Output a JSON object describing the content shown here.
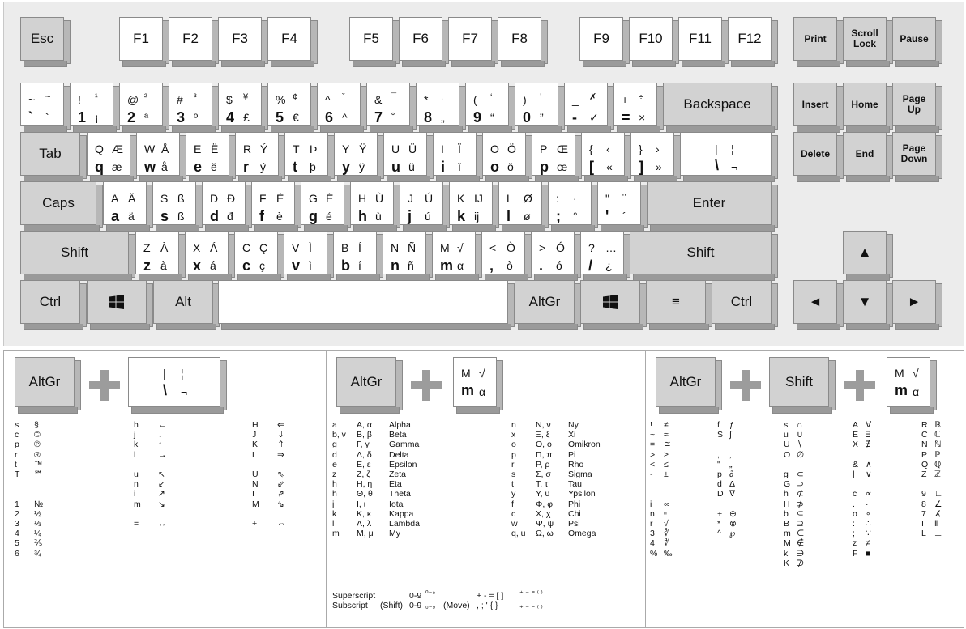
{
  "keyboard": {
    "function_row": [
      "Esc",
      "F1",
      "F2",
      "F3",
      "F4",
      "F5",
      "F6",
      "F7",
      "F8",
      "F9",
      "F10",
      "F11",
      "F12"
    ],
    "nav_top": [
      "Print",
      "Scroll\nLock",
      "Pause"
    ],
    "nav_mid": [
      "Insert",
      "Home",
      "Page\nUp"
    ],
    "nav_bot": [
      "Delete",
      "End",
      "Page\nDown"
    ],
    "arrows": {
      "up": "▲",
      "left": "◄",
      "down": "▼",
      "right": "►"
    },
    "number_row": [
      [
        "~",
        "~",
        "`",
        "`"
      ],
      [
        "!",
        "¹",
        "1",
        "¡"
      ],
      [
        "@",
        "²",
        "2",
        "ª"
      ],
      [
        "#",
        "³",
        "3",
        "º"
      ],
      [
        "$",
        "¥",
        "4",
        "£"
      ],
      [
        "%",
        "¢",
        "5",
        "€"
      ],
      [
        "^",
        "ˇ",
        "6",
        "^"
      ],
      [
        "&",
        "¯",
        "7",
        "˚"
      ],
      [
        "*",
        ",",
        "8",
        "„"
      ],
      [
        "(",
        "‘",
        "9",
        "“"
      ],
      [
        ")",
        "’",
        "0",
        "”"
      ],
      [
        "_",
        "✗",
        "-",
        "✓"
      ],
      [
        "+",
        "÷",
        "=",
        "×"
      ]
    ],
    "backspace": "Backspace",
    "tab": "Tab",
    "q_row": [
      [
        "Q",
        "Æ",
        "q",
        "æ"
      ],
      [
        "W",
        "Å",
        "w",
        "å"
      ],
      [
        "E",
        "Ë",
        "e",
        "ë"
      ],
      [
        "R",
        "Ý",
        "r",
        "ý"
      ],
      [
        "T",
        "Þ",
        "t",
        "þ"
      ],
      [
        "Y",
        "Ÿ",
        "y",
        "ÿ"
      ],
      [
        "U",
        "Ü",
        "u",
        "ü"
      ],
      [
        "I",
        "Ï",
        "i",
        "ï"
      ],
      [
        "O",
        "Ö",
        "o",
        "ö"
      ],
      [
        "P",
        "Œ",
        "p",
        "œ"
      ],
      [
        "{",
        "‹",
        "[",
        "«"
      ],
      [
        "}",
        "›",
        "]",
        "»"
      ],
      [
        "|",
        "¦",
        "\\",
        "¬"
      ]
    ],
    "caps": "Caps",
    "a_row": [
      [
        "A",
        "Ä",
        "a",
        "ä"
      ],
      [
        "S",
        "ß",
        "s",
        "ß"
      ],
      [
        "D",
        "Đ",
        "d",
        "đ"
      ],
      [
        "F",
        "È",
        "f",
        "è"
      ],
      [
        "G",
        "É",
        "g",
        "é"
      ],
      [
        "H",
        "Ù",
        "h",
        "ù"
      ],
      [
        "J",
        "Ú",
        "j",
        "ú"
      ],
      [
        "K",
        "IJ",
        "k",
        "ij"
      ],
      [
        "L",
        "Ø",
        "l",
        "ø"
      ],
      [
        ":",
        "·",
        ";",
        "°"
      ],
      [
        "\"",
        "¨",
        "'",
        "´"
      ]
    ],
    "enter": "Enter",
    "shift": "Shift",
    "z_row": [
      [
        "Z",
        "À",
        "z",
        "à"
      ],
      [
        "X",
        "Á",
        "x",
        "á"
      ],
      [
        "C",
        "Ç",
        "c",
        "ç"
      ],
      [
        "V",
        "Ì",
        "v",
        "ì"
      ],
      [
        "B",
        "Í",
        "b",
        "í"
      ],
      [
        "N",
        "Ñ",
        "n",
        "ñ"
      ],
      [
        "M",
        "√",
        "m",
        "α"
      ],
      [
        "<",
        "Ò",
        ",",
        "ò"
      ],
      [
        ">",
        "Ó",
        ".",
        "ó"
      ],
      [
        "?",
        "…",
        "/",
        "¿"
      ]
    ],
    "bottom": {
      "ctrl": "Ctrl",
      "alt": "Alt",
      "altgr": "AltGr",
      "menu": "≡",
      "win": "win"
    }
  },
  "reference": {
    "panel1": {
      "keys": [
        "AltGr",
        "+"
      ],
      "key_glyphs": [
        "|",
        "¦",
        "\\",
        "¬"
      ],
      "cols": [
        "s\nc\np\nr\nt\nT\n\n\n1\n2\n3\n4\n5\n6",
        "§\n©\n℗\n®\n™\n℠\n\n\n№\n½\n⅓\n¼\n⅖\n¾",
        "h\nj\nk\nl\n\nu\nn\ni\nm\n\n=",
        "←\n↓\n↑\n→\n\n↖\n↙\n↗\n↘\n\n↔",
        "H\nJ\nK\nL\n\nU\nN\nI\nM\n\n+",
        "⇐\n⇓\n⇑\n⇒\n\n⇖\n⇙\n⇗\n⇘\n\n⇔"
      ]
    },
    "panel2": {
      "keys": [
        "AltGr"
      ],
      "key_glyphs": [
        "M",
        "√",
        "m",
        "α"
      ],
      "cols": [
        "a\nb, v\ng\nd\ne\nz\nh\nh\nj\nk\nl\nm",
        "Α, α\nΒ, β\nΓ, γ\nΔ, δ\nΕ, ε\nΖ, ζ\nΗ, η\nΘ, θ\nΙ, ι\nΚ, κ\nΛ, λ\nΜ, μ",
        "Alpha\nBeta\nGamma\nDelta\nEpsilon\nZeta\nEta\nTheta\nIota\nKappa\nLambda\nMy",
        "n\nx\no\np\nr\ns\nt\ny\nf\nc\nw\nq, u",
        "Ν, ν\nΞ, ξ\nΟ, ο\nΠ, π\nΡ, ρ\nΣ, σ\nΤ, τ\nΥ, υ\nΦ, φ\nΧ, χ\nΨ, ψ\nΩ, ω",
        "Ny\nXi\nOmikron\nPi\nRho\nSigma\nTau\nYpsilon\nPhi\nChi\nPsi\nOmega"
      ],
      "superscript_label": "Superscript",
      "subscript_label": "Subscript",
      "shift_label": "(Shift)",
      "move_label": "(Move)",
      "range": "0-9",
      "sup_glyphs": "⁰⁻⁹",
      "sub_glyphs": "₀₋₉",
      "sup_keys": "+ - = [ ]",
      "sub_keys": ", ; ' { }",
      "sup_result": "⁺ ⁻ ⁼ ⁽ ⁾",
      "sub_result": "₊ ₋ ₌ ₍ ₎"
    },
    "panel3": {
      "keys": [
        "AltGr",
        "Shift"
      ],
      "key_glyphs": [
        "M",
        "√",
        "m",
        "α"
      ],
      "cols": [
        "!\n~\n=\n>\n<\n-\n\n\ni\nn\nr\n3\n4\n%",
        "≠\n≈\n≅\n≥\n≤\n±\n\n\n∞\nⁿ\n√\n∛\n∜\n‰",
        "f\nS\n\n,\n\"\np\nd\nD\n\n+\n*\n^",
        "ƒ\n∫\n\n‚\n„\n∂\nΔ\n∇\n\n⊕\n⊗\n℘",
        "s\nu\nU\nO\n\ng\nG\nh\nH\nb\nB\nm\nM\nk\nK",
        "∩\n∪\n∖\n∅\n\n⊂\n⊃\n⊄\n⊅\n⊆\n⊇\n∈\n∉\n∋\n∌",
        "A\nE\nX\n\n&\n|\n\nc\n.\no\n:\n;\nz\nF",
        "∀\n∃\n∄\n\n∧\n∨\n\n∝\n·\n∘\n∴\n∵\n≠\n■",
        "R\nC\nN\nP\nQ\nZ\n\n9\n8\n7\nI\nL",
        "ℝ\nℂ\nℕ\nℙ\nℚ\nℤ\n\n∟\n∠\n∡\n‖\n⊥"
      ]
    }
  }
}
